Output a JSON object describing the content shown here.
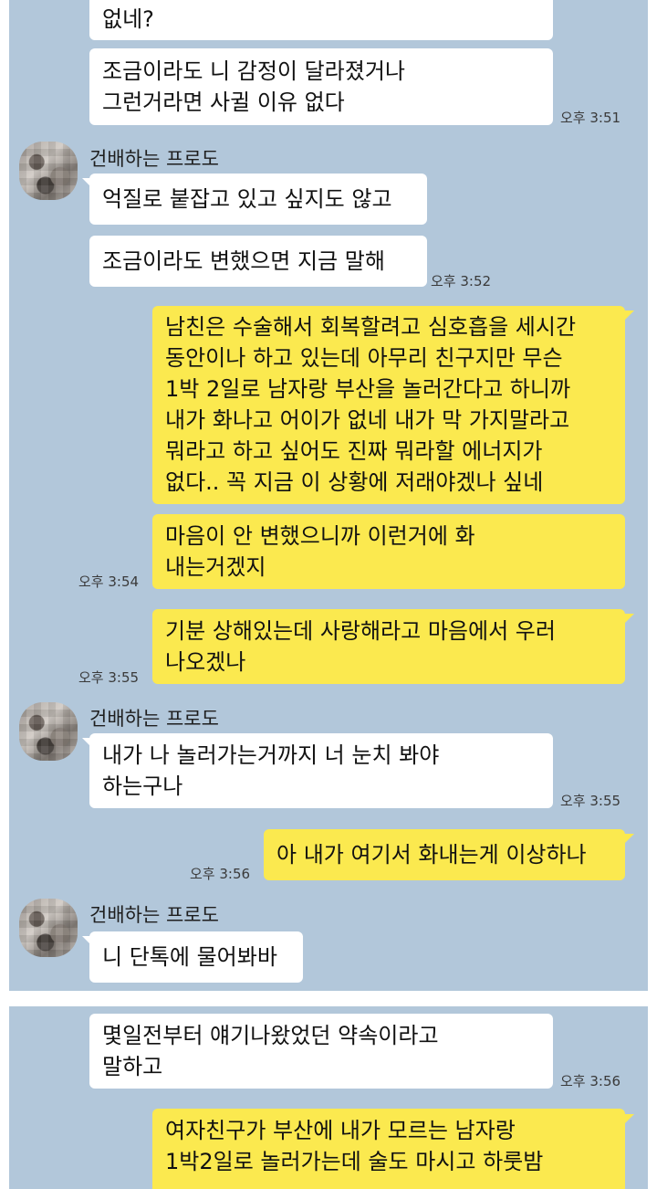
{
  "chat": {
    "friend_name": "건배하는 프로도",
    "panel1": {
      "m1": [
        "없네?"
      ],
      "m2": [
        "조금이라도 니 감정이 달라졌거나",
        "그런거라면 사귈 이유 없다"
      ],
      "t2": "오후 3:51",
      "m3": [
        "억질로 붙잡고 있고 싶지도 않고"
      ],
      "m4": [
        "조금이라도 변했으면 지금 말해"
      ],
      "t4": "오후 3:52",
      "m5": [
        "남친은 수술해서 회복할려고 심호흡을 세시간",
        "동안이나 하고 있는데 아무리 친구지만 무슨",
        "1박 2일로 남자랑 부산을 놀러간다고 하니까",
        "내가 화나고 어이가 없네 내가 막 가지말라고",
        "뭐라고 하고 싶어도 진짜 뭐라할 에너지가",
        "없다.. 꼭 지금 이 상황에 저래야겠나 싶네"
      ],
      "m6": [
        "마음이 안 변했으니까 이런거에 화",
        "내는거겠지"
      ],
      "t6": "오후 3:54",
      "m7": [
        "기분 상해있는데 사랑해라고 마음에서 우러",
        "나오겠나"
      ],
      "t7": "오후 3:55",
      "m8": [
        "내가 나 놀러가는거까지 너 눈치 봐야",
        "하는구나"
      ],
      "t8": "오후 3:55",
      "m9": [
        "아 내가 여기서 화내는게 이상하나"
      ],
      "t9": "오후 3:56",
      "m10": [
        "니 단톡에 물어봐바"
      ]
    },
    "panel2": {
      "m11": [
        "몇일전부터 얘기나왔었던 약속이라고",
        "말하고"
      ],
      "t11": "오후 3:56",
      "m12": [
        "여자친구가 부산에 내가 모르는 남자랑",
        "1박2일로 놀러가는데 술도 마시고 하룻밤"
      ]
    }
  }
}
